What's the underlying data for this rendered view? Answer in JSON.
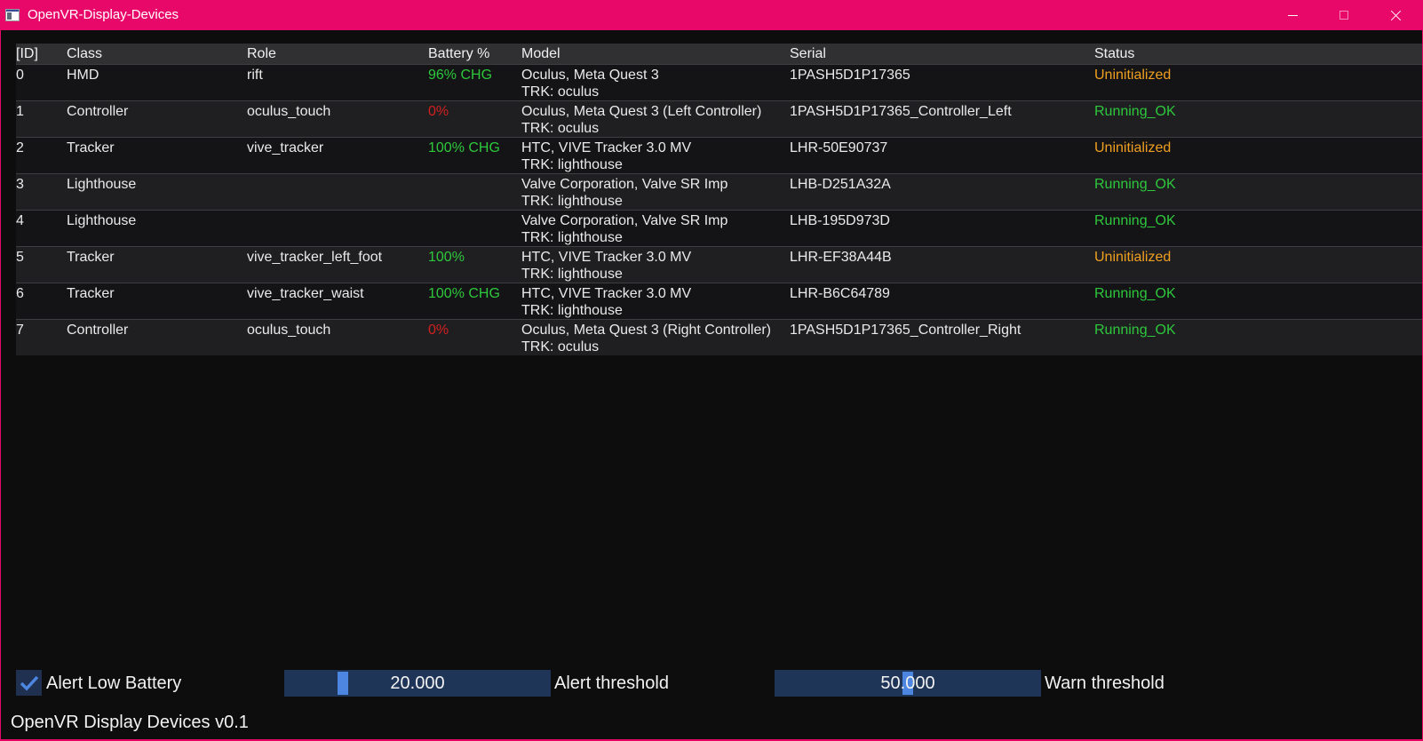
{
  "window": {
    "title": "OpenVR-Display-Devices"
  },
  "colors": {
    "titlebar": "#e8086a",
    "background": "#0d0d0e",
    "green": "#2ec83c",
    "red": "#d02020",
    "orange": "#f0a020",
    "slider_bg": "#1f3558",
    "slider_grab": "#4c86e0"
  },
  "table": {
    "headers": [
      "[ID]",
      "Class",
      "Role",
      "Battery %",
      "Model",
      "Serial",
      "Status"
    ],
    "rows": [
      {
        "id": "0",
        "class": "HMD",
        "role": "rift",
        "battery": "96% CHG",
        "battery_color": "green",
        "model": "Oculus, Meta Quest 3",
        "trk": "TRK: oculus",
        "serial": "1PASH5D1P17365",
        "status": "Uninitialized",
        "status_color": "orange"
      },
      {
        "id": "1",
        "class": "Controller",
        "role": "oculus_touch",
        "battery": "0%",
        "battery_color": "red",
        "model": "Oculus, Meta Quest 3 (Left Controller)",
        "trk": "TRK: oculus",
        "serial": "1PASH5D1P17365_Controller_Left",
        "status": "Running_OK",
        "status_color": "green"
      },
      {
        "id": "2",
        "class": "Tracker",
        "role": "vive_tracker",
        "battery": "100% CHG",
        "battery_color": "green",
        "model": "HTC, VIVE Tracker 3.0 MV",
        "trk": "TRK: lighthouse",
        "serial": "LHR-50E90737",
        "status": "Uninitialized",
        "status_color": "orange"
      },
      {
        "id": "3",
        "class": "Lighthouse",
        "role": "",
        "battery": "",
        "battery_color": "green",
        "model": "Valve Corporation, Valve SR Imp",
        "trk": "TRK: lighthouse",
        "serial": "LHB-D251A32A",
        "status": "Running_OK",
        "status_color": "green"
      },
      {
        "id": "4",
        "class": "Lighthouse",
        "role": "",
        "battery": "",
        "battery_color": "green",
        "model": "Valve Corporation, Valve SR Imp",
        "trk": "TRK: lighthouse",
        "serial": "LHB-195D973D",
        "status": "Running_OK",
        "status_color": "green"
      },
      {
        "id": "5",
        "class": "Tracker",
        "role": "vive_tracker_left_foot",
        "battery": "100%",
        "battery_color": "green",
        "model": "HTC, VIVE Tracker 3.0 MV",
        "trk": "TRK: lighthouse",
        "serial": "LHR-EF38A44B",
        "status": "Uninitialized",
        "status_color": "orange"
      },
      {
        "id": "6",
        "class": "Tracker",
        "role": "vive_tracker_waist",
        "battery": "100% CHG",
        "battery_color": "green",
        "model": "HTC, VIVE Tracker 3.0 MV",
        "trk": "TRK: lighthouse",
        "serial": "LHR-B6C64789",
        "status": "Running_OK",
        "status_color": "green"
      },
      {
        "id": "7",
        "class": "Controller",
        "role": "oculus_touch",
        "battery": "0%",
        "battery_color": "red",
        "model": "Oculus, Meta Quest 3 (Right Controller)",
        "trk": "TRK: oculus",
        "serial": "1PASH5D1P17365_Controller_Right",
        "status": "Running_OK",
        "status_color": "green"
      }
    ]
  },
  "controls": {
    "alert_low_battery_label": "Alert Low Battery",
    "alert_low_battery_checked": true,
    "alert_threshold_value": "20.000",
    "alert_threshold_fraction": 0.2,
    "alert_threshold_label": "Alert threshold",
    "warn_threshold_value": "50.000",
    "warn_threshold_fraction": 0.5,
    "warn_threshold_label": "Warn threshold"
  },
  "footer": {
    "version": "OpenVR Display Devices v0.1"
  }
}
